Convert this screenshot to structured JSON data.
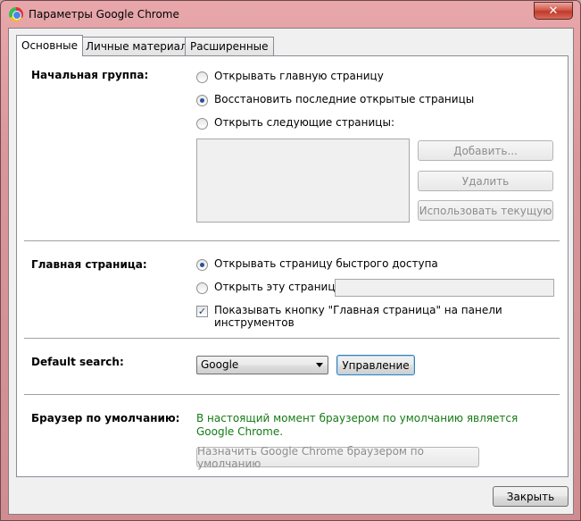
{
  "window": {
    "title": "Параметры Google Chrome",
    "close_glyph": "✕"
  },
  "tabs": [
    {
      "label": "Основные",
      "active": true
    },
    {
      "label": "Личные материалы",
      "active": false
    },
    {
      "label": "Расширенные",
      "active": false
    }
  ],
  "startup": {
    "label": "Начальная группа:",
    "options": [
      {
        "label": "Открывать главную страницу",
        "checked": false
      },
      {
        "label": "Восстановить последние открытые страницы",
        "checked": true
      },
      {
        "label": "Открыть следующие страницы:",
        "checked": false
      }
    ],
    "buttons": {
      "add": "Добавить...",
      "remove": "Удалить",
      "use_current": "Использовать текущую"
    }
  },
  "homepage": {
    "label": "Главная страница:",
    "options": [
      {
        "label": "Открывать страницу быстрого доступа",
        "checked": true
      },
      {
        "label": "Открыть эту страницу:",
        "checked": false
      }
    ],
    "url_value": "",
    "show_button_label": "Показывать кнопку \"Главная страница\" на панели инструментов",
    "show_button_checked": true
  },
  "search": {
    "label": "Default search:",
    "selected": "Google",
    "manage_label": "Управление"
  },
  "default_browser": {
    "label": "Браузер по умолчанию:",
    "status": "В настоящий момент браузером по умолчанию является Google Chrome.",
    "status_color": "#157a15",
    "make_default_label": "Назначить Google Chrome браузером по умолчанию"
  },
  "footer": {
    "close_label": "Закрыть"
  },
  "colors": {
    "accent": "#2a4f9c",
    "frame": "#e8a7ab"
  }
}
